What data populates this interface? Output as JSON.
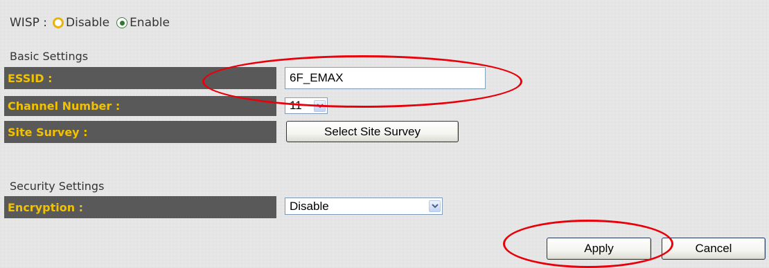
{
  "wisp": {
    "label": "WISP :",
    "options": [
      {
        "label": "Disable",
        "selected": false
      },
      {
        "label": "Enable",
        "selected": true
      }
    ]
  },
  "basic_settings": {
    "title": "Basic Settings",
    "essid": {
      "label": "ESSID :",
      "value": "6F_EMAX"
    },
    "channel": {
      "label": "Channel Number :",
      "value": "11"
    },
    "site_survey": {
      "label": "Site Survey :",
      "button": "Select Site Survey"
    }
  },
  "security_settings": {
    "title": "Security Settings",
    "encryption": {
      "label": "Encryption :",
      "value": "Disable"
    }
  },
  "actions": {
    "apply": "Apply",
    "cancel": "Cancel"
  },
  "colors": {
    "label_bg": "#595959",
    "label_text": "#f2c200",
    "highlight_ellipse": "#e8000b"
  },
  "icons": {
    "dropdown": "chevron-down-icon",
    "annotation": "red-ellipse-highlight"
  }
}
